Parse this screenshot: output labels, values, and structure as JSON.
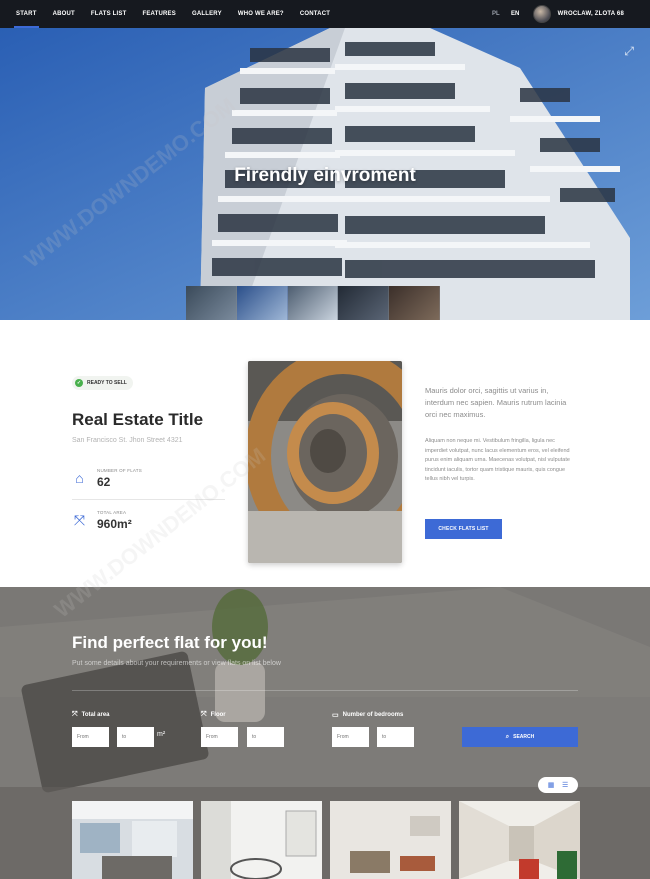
{
  "nav": {
    "items": [
      "START",
      "ABOUT",
      "FLATS LIST",
      "FEATURES",
      "GALLERY",
      "WHO WE ARE?",
      "CONTACT"
    ],
    "langs": [
      "PL",
      "EN"
    ],
    "user": "WROCLAW, ZLOTA 68"
  },
  "hero": {
    "title": "Firendly einvroment",
    "expand_icon": "expand-icon"
  },
  "info": {
    "badge": "READY TO SELL",
    "title": "Real Estate Title",
    "address": "San Francisco St. Jhon Street 4321",
    "stats": [
      {
        "label": "NUMBER OF FLATS",
        "value": "62",
        "icon": "home-icon"
      },
      {
        "label": "TOTAL AREA",
        "value": "960m²",
        "icon": "area-icon"
      }
    ],
    "lead": "Mauris dolor orci, sagittis ut varius in, interdum nec sapien. Mauris rutrum lacinia orci nec maximus.",
    "body": "Aliquam non neque mi. Vestibulum fringilla, ligula nec imperdiet volutpat, nunc lacus elementum eros, vel eleifend purus enim aliquam urna. Maecenas volutpat, nisl vulputate tincidunt iaculis, tortor quam tristique mauris, quis congue tellus nibh vel turpis.",
    "button": "CHECK FLATS LIST"
  },
  "search": {
    "title": "Find perfect flat for you!",
    "subtitle": "Put some details about your requirements or view flats on list below",
    "fields": [
      {
        "label": "Total area",
        "from": "From",
        "to": "to",
        "unit": "m²"
      },
      {
        "label": "Floor",
        "from": "From",
        "to": "to"
      },
      {
        "label": "Number of bedrooms",
        "from": "From",
        "to": "to"
      }
    ],
    "button": "SEARCH"
  },
  "colors": {
    "accent": "#3d6ad6",
    "nav_bg": "#16191f",
    "badge_green": "#48b04c"
  }
}
